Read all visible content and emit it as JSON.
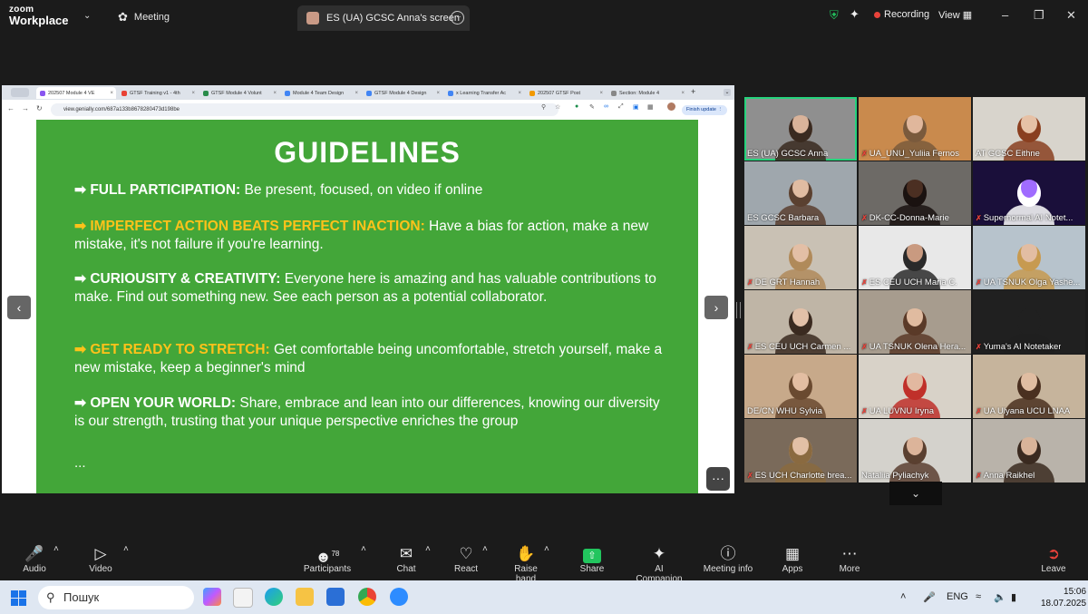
{
  "app": {
    "logo_line1": "zoom",
    "logo_line2": "Workplace",
    "meeting_label": "Meeting"
  },
  "screen_tab": {
    "label": "ES (UA) GCSC Anna's screen"
  },
  "title_right": {
    "recording": "Recording",
    "view": "View"
  },
  "browser": {
    "tabs": [
      {
        "label": "202507 Module 4 VE",
        "color": "#8a56f0",
        "active": true
      },
      {
        "label": "GTSF Training v1 - 4th",
        "color": "#e94235",
        "active": false
      },
      {
        "label": "GTSF Module 4 Volunt",
        "color": "#2a8c4a",
        "active": false
      },
      {
        "label": "Module 4 Team Design",
        "color": "#4285f4",
        "active": false
      },
      {
        "label": "GTSF Module 4 Design",
        "color": "#4285f4",
        "active": false
      },
      {
        "label": "x Learning Transfer Ac",
        "color": "#4285f4",
        "active": false
      },
      {
        "label": "202507 GTSF Post",
        "color": "#f29900",
        "active": false
      },
      {
        "label": "Section: Module 4",
        "color": "#888888",
        "active": false
      }
    ],
    "url": "view.genially.com/687a133b8678280473d198be",
    "finish_update": "Finish update"
  },
  "slide": {
    "title": "GUIDELINES",
    "items": [
      {
        "arrow": "➡",
        "heading": "FULL PARTICIPATION:",
        "text": "Be present, focused, on video if online",
        "highlight": false
      },
      {
        "arrow": "➡",
        "heading": "IMPERFECT ACTION BEATS PERFECT INACTION:",
        "text": "Have a bias for action, make a new mistake, it's not failure if you're learning.",
        "highlight": true
      },
      {
        "arrow": "➡",
        "heading": "CURIOUSITY & CREATIVITY:",
        "text": "Everyone here is amazing and has valuable contributions to make. Find out something new. See each person as a potential collaborator.",
        "highlight": false
      },
      {
        "arrow": "➡",
        "heading": "GET READY TO STRETCH:",
        "text": "Get comfortable being uncomfortable, stretch yourself, make a new mistake, keep a beginner's mind",
        "highlight": true
      },
      {
        "arrow": "➡",
        "heading": "OPEN YOUR WORLD:",
        "text": "Share, embrace and lean into our differences, knowing our diversity is our strength, trusting that your unique perspective enriches the group",
        "highlight": false
      }
    ],
    "ellipsis": "..."
  },
  "participants": [
    {
      "name": "ES (UA) GCSC Anna",
      "muted": false,
      "active": true,
      "bg": "#8f8f8f",
      "skin": "#d9b39a",
      "hair": "#3a2a20"
    },
    {
      "name": "UA_UNU_Yuliia Fernos",
      "muted": true,
      "active": false,
      "bg": "#c98a4d",
      "skin": "#e0b79c",
      "hair": "#7a5a3c"
    },
    {
      "name": "AT GCSC Eithne",
      "muted": false,
      "active": false,
      "bg": "#d8d4cc",
      "skin": "#e6c1a6",
      "hair": "#8a3f20"
    },
    {
      "name": "ES GCSC Barbara",
      "muted": false,
      "active": false,
      "bg": "#9fa7ad",
      "skin": "#e0bca2",
      "hair": "#5a4030"
    },
    {
      "name": "DK-CC-Donna-Marie",
      "muted": true,
      "active": false,
      "bg": "#6d6a66",
      "skin": "#4b2f22",
      "hair": "#1a1210"
    },
    {
      "name": "Supernormal AI Notet...",
      "muted": true,
      "active": false,
      "bg": "#1a0f3a",
      "skin": "#a06cff",
      "hair": "#ffffff"
    },
    {
      "name": "DE GRT Hannah",
      "muted": true,
      "active": false,
      "bg": "#c9c1b4",
      "skin": "#e3bfa6",
      "hair": "#b08a5a"
    },
    {
      "name": "ES CEU UCH Maria C.",
      "muted": true,
      "active": false,
      "bg": "#e8e8e8",
      "skin": "#c99a80",
      "hair": "#2a2a2a"
    },
    {
      "name": "UA TSNUK Olga Yashe...",
      "muted": true,
      "active": false,
      "bg": "#b7c3cc",
      "skin": "#e2bda3",
      "hair": "#c79a50"
    },
    {
      "name": "ES CEU UCH Carmen ...",
      "muted": true,
      "active": false,
      "bg": "#bfb5a6",
      "skin": "#e2c0a8",
      "hair": "#3a2a20"
    },
    {
      "name": "UA TSNUK Olena Hera...",
      "muted": true,
      "active": false,
      "bg": "#a79c8e",
      "skin": "#e0bba0",
      "hair": "#5a3a28"
    },
    {
      "name": "Yuma's AI Notetaker",
      "muted": true,
      "active": false,
      "bg": "#202020",
      "skin": "#202020",
      "hair": "#202020"
    },
    {
      "name": "DE/CN WHU Sylvia",
      "muted": false,
      "active": false,
      "bg": "#c7a98a",
      "skin": "#e3bea2",
      "hair": "#6a4a30"
    },
    {
      "name": "UA LUVNU Iryna",
      "muted": true,
      "active": false,
      "bg": "#d8d2c8",
      "skin": "#e2b8a0",
      "hair": "#c0302a"
    },
    {
      "name": "UA Ulyana UCU LNAA",
      "muted": true,
      "active": false,
      "bg": "#c6b49c",
      "skin": "#e0bda2",
      "hair": "#4a3020"
    },
    {
      "name": "ES UCH Charlotte brea...",
      "muted": true,
      "active": false,
      "bg": "#7a6a5a",
      "skin": "#e2c0a6",
      "hair": "#8a6a40"
    },
    {
      "name": "Nataliia Pyliachyk",
      "muted": false,
      "active": false,
      "bg": "#d4d2cc",
      "skin": "#dcb49a",
      "hair": "#5a4030"
    },
    {
      "name": "Anna Raikhel",
      "muted": true,
      "active": false,
      "bg": "#b9b3aa",
      "skin": "#d9b49a",
      "hair": "#3a2a20"
    }
  ],
  "toolbar": {
    "audio": "Audio",
    "video": "Video",
    "participants": "Participants",
    "participants_count": "78",
    "chat": "Chat",
    "react": "React",
    "raise_hand": "Raise hand",
    "share": "Share",
    "ai_companion": "AI Companion",
    "meeting_info": "Meeting info",
    "apps": "Apps",
    "more": "More",
    "leave": "Leave"
  },
  "taskbar": {
    "search_placeholder": "Пошук",
    "lang": "ENG",
    "time": "15:06",
    "date": "18.07.2025"
  },
  "colors": {
    "slide_green": "#43a639",
    "highlight_yellow": "#ffc21a",
    "active_speaker": "#26d37c",
    "recording_red": "#e8423a"
  }
}
